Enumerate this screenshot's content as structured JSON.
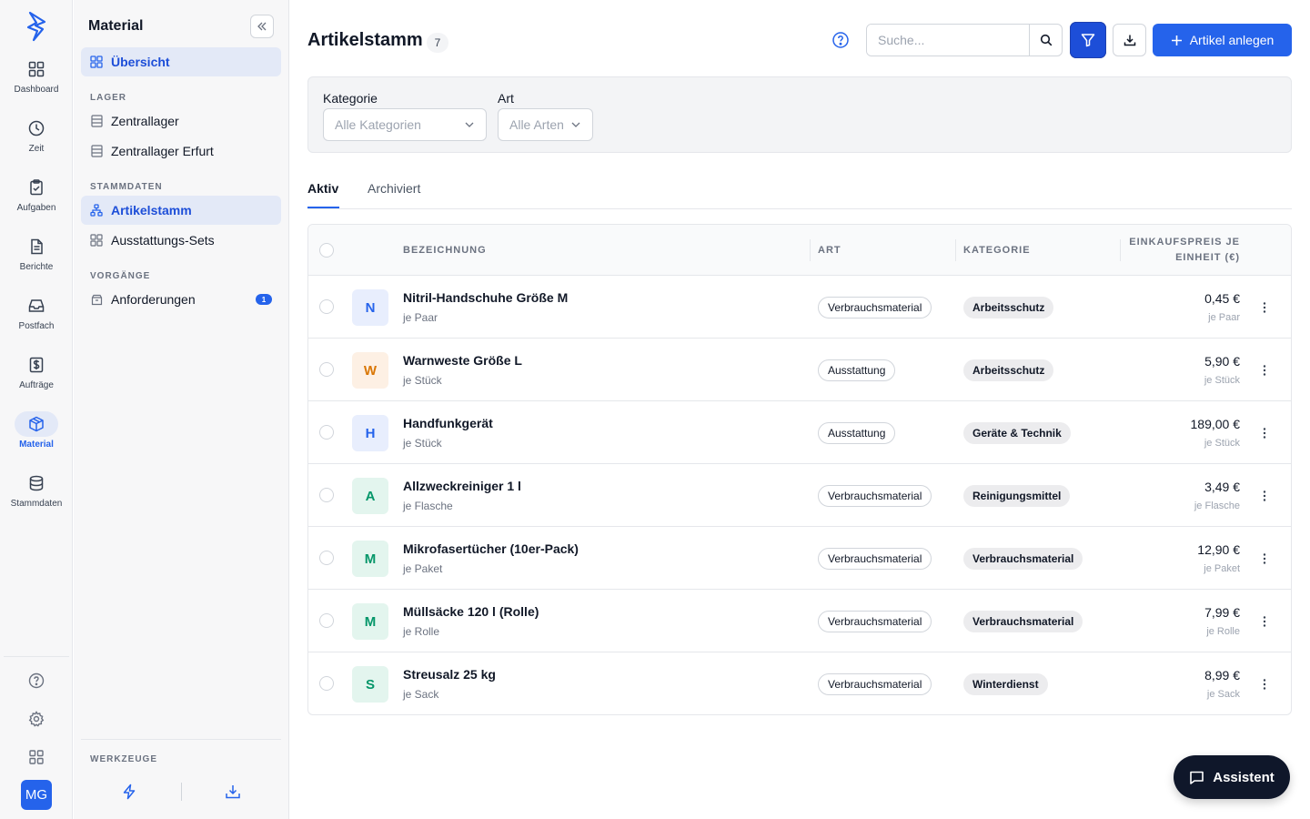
{
  "rail": {
    "items": [
      {
        "label": "Dashboard",
        "icon": "dashboard-icon"
      },
      {
        "label": "Zeit",
        "icon": "clock-icon"
      },
      {
        "label": "Aufgaben",
        "icon": "clipboard-check-icon"
      },
      {
        "label": "Berichte",
        "icon": "document-icon"
      },
      {
        "label": "Postfach",
        "icon": "inbox-icon"
      },
      {
        "label": "Aufträge",
        "icon": "dollar-doc-icon"
      },
      {
        "label": "Material",
        "icon": "box-icon",
        "active": true
      },
      {
        "label": "Stammdaten",
        "icon": "database-icon"
      }
    ],
    "avatar_initials": "MG"
  },
  "sidebar": {
    "title": "Material",
    "overview_label": "Übersicht",
    "sections": {
      "lager": "LAGER",
      "stammdaten": "STAMMDATEN",
      "vorgaenge": "VORGÄNGE",
      "werkzeuge": "WERKZEUGE"
    },
    "lager_items": [
      "Zentrallager",
      "Zentrallager Erfurt"
    ],
    "stammdaten_items": [
      "Artikelstamm",
      "Ausstattungs-Sets"
    ],
    "vorgaenge_items": [
      {
        "label": "Anforderungen",
        "badge": "1"
      }
    ]
  },
  "header": {
    "title": "Artikelstamm",
    "count": "7",
    "search_placeholder": "Suche...",
    "add_label": "Artikel anlegen"
  },
  "filters": {
    "kategorie_label": "Kategorie",
    "kategorie_value": "Alle Kategorien",
    "art_label": "Art",
    "art_value": "Alle Arten"
  },
  "tabs": {
    "active": "Aktiv",
    "archived": "Archiviert"
  },
  "table": {
    "headers": {
      "name": "BEZEICHNUNG",
      "art": "ART",
      "kategorie": "KATEGORIE",
      "price_line1": "EINKAUFSPREIS JE",
      "price_line2": "EINHEIT (€)"
    },
    "rows": [
      {
        "initial": "N",
        "name": "Nitril-Handschuhe Größe M",
        "unit": "je Paar",
        "art": "Verbrauchsmaterial",
        "kategorie": "Arbeitsschutz",
        "price": "0,45 €",
        "price_unit": "je Paar",
        "avatar_bg": "#e8eefd",
        "avatar_fg": "#2563eb"
      },
      {
        "initial": "W",
        "name": "Warnweste Größe L",
        "unit": "je Stück",
        "art": "Ausstattung",
        "kategorie": "Arbeitsschutz",
        "price": "5,90 €",
        "price_unit": "je Stück",
        "avatar_bg": "#fdf0e4",
        "avatar_fg": "#d97706"
      },
      {
        "initial": "H",
        "name": "Handfunkgerät",
        "unit": "je Stück",
        "art": "Ausstattung",
        "kategorie": "Geräte & Technik",
        "price": "189,00 €",
        "price_unit": "je Stück",
        "avatar_bg": "#e8eefd",
        "avatar_fg": "#2563eb"
      },
      {
        "initial": "A",
        "name": "Allzweckreiniger 1 l",
        "unit": "je Flasche",
        "art": "Verbrauchsmaterial",
        "kategorie": "Reinigungsmittel",
        "price": "3,49 €",
        "price_unit": "je Flasche",
        "avatar_bg": "#e3f5ee",
        "avatar_fg": "#059669"
      },
      {
        "initial": "M",
        "name": "Mikrofasertücher (10er-Pack)",
        "unit": "je Paket",
        "art": "Verbrauchsmaterial",
        "kategorie": "Verbrauchsmaterial",
        "price": "12,90 €",
        "price_unit": "je Paket",
        "avatar_bg": "#e3f5ee",
        "avatar_fg": "#059669"
      },
      {
        "initial": "M",
        "name": "Müllsäcke 120 l (Rolle)",
        "unit": "je Rolle",
        "art": "Verbrauchsmaterial",
        "kategorie": "Verbrauchsmaterial",
        "price": "7,99 €",
        "price_unit": "je Rolle",
        "avatar_bg": "#e3f5ee",
        "avatar_fg": "#059669"
      },
      {
        "initial": "S",
        "name": "Streusalz 25 kg",
        "unit": "je Sack",
        "art": "Verbrauchsmaterial",
        "kategorie": "Winterdienst",
        "price": "8,99 €",
        "price_unit": "je Sack",
        "avatar_bg": "#e3f5ee",
        "avatar_fg": "#059669"
      }
    ]
  },
  "assistant_label": "Assistent",
  "colors": {
    "accent": "#2563eb",
    "dark": "#0f172a"
  }
}
